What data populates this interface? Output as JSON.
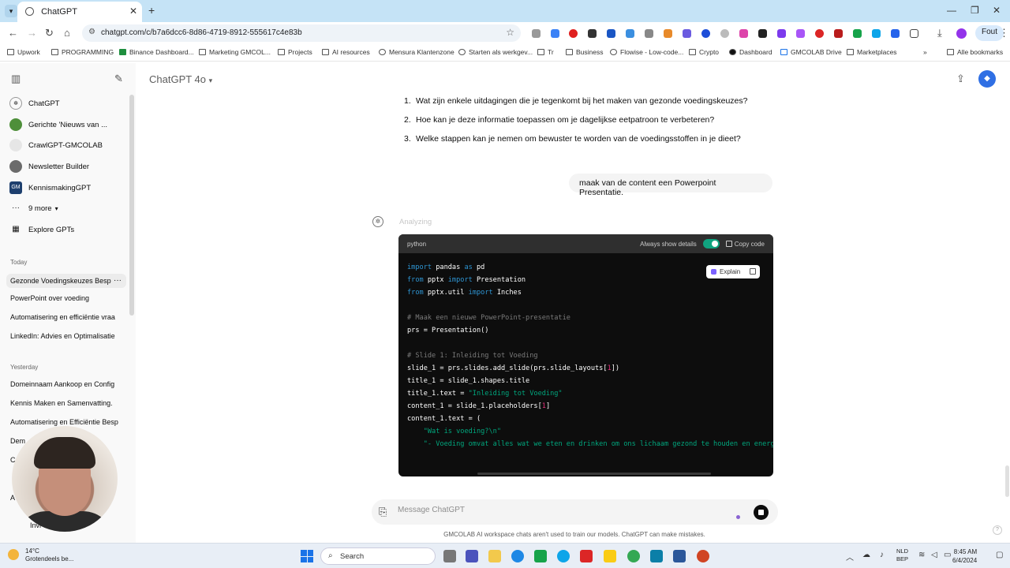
{
  "browser": {
    "tab_title": "ChatGPT",
    "url": "chatgpt.com/c/b7a6dcc6-8d86-4719-8912-555617c4e83b",
    "profile_label": "Fout",
    "bookmarks": [
      "Upwork",
      "PROGRAMMING",
      "Binance Dashboard...",
      "Marketing GMCOL...",
      "Projects",
      "AI resources",
      "Mensura Klantenzone",
      "Starten als werkgev...",
      "Tr",
      "Business",
      "Flowise - Low-code...",
      "Crypto",
      "Dashboard",
      "GMCOLAB Drive",
      "Marketplaces"
    ],
    "all_bookmarks": "Alle bookmarks"
  },
  "sidebar": {
    "gpts": [
      {
        "label": "ChatGPT",
        "color": "#ffffff"
      },
      {
        "label": "Gerichte 'Nieuws van ...",
        "color": "#4e8f3a"
      },
      {
        "label": "CrawlGPT-GMCOLAB",
        "color": "#e6e6e6"
      },
      {
        "label": "Newsletter Builder",
        "color": "#6b6b6b"
      },
      {
        "label": "KennismakingGPT",
        "color": "#1d3f6e"
      }
    ],
    "more": "9 more",
    "explore": "Explore GPTs",
    "today_label": "Today",
    "today": [
      "Gezonde Voedingskeuzes Besp",
      "PowerPoint over voeding",
      "Automatisering en efficiëntie vraa",
      "LinkedIn: Advies en Optimalisatie"
    ],
    "yesterday_label": "Yesterday",
    "yesterday": [
      "Domeinnaam Aankoop en Config",
      "Kennis Maken en Samenvatting.",
      "Automatisering en Efficiëntie Besp",
      "Dem",
      "C",
      "A"
    ],
    "invite": "Invi"
  },
  "main": {
    "model": "ChatGPT 4o",
    "questions": [
      {
        "num": "1.",
        "text": "Wat zijn enkele uitdagingen die je tegenkomt bij het maken van gezonde voedingskeuzes?"
      },
      {
        "num": "2.",
        "text": "Hoe kan je deze informatie toepassen om je dagelijkse eetpatroon te verbeteren?"
      },
      {
        "num": "3.",
        "text": "Welke stappen kan je nemen om bewuster te worden van de voedingsstoffen in je dieet?"
      }
    ],
    "user_message": "maak van de content een Powerpoint Presentatie.",
    "analyzing": "Analyzing",
    "code_lang": "python",
    "always_show": "Always show details",
    "copy_code": "Copy code",
    "explain": "Explain",
    "placeholder": "Message ChatGPT",
    "disclaimer": "GMCOLAB AI workspace chats aren't used to train our models. ChatGPT can make mistakes."
  },
  "taskbar": {
    "temp": "14°C",
    "weather": "Grotendeels be...",
    "search": "Search",
    "lang_top": "NLD",
    "lang_bottom": "BEP",
    "time": "8:45 AM",
    "date": "6/4/2024"
  }
}
